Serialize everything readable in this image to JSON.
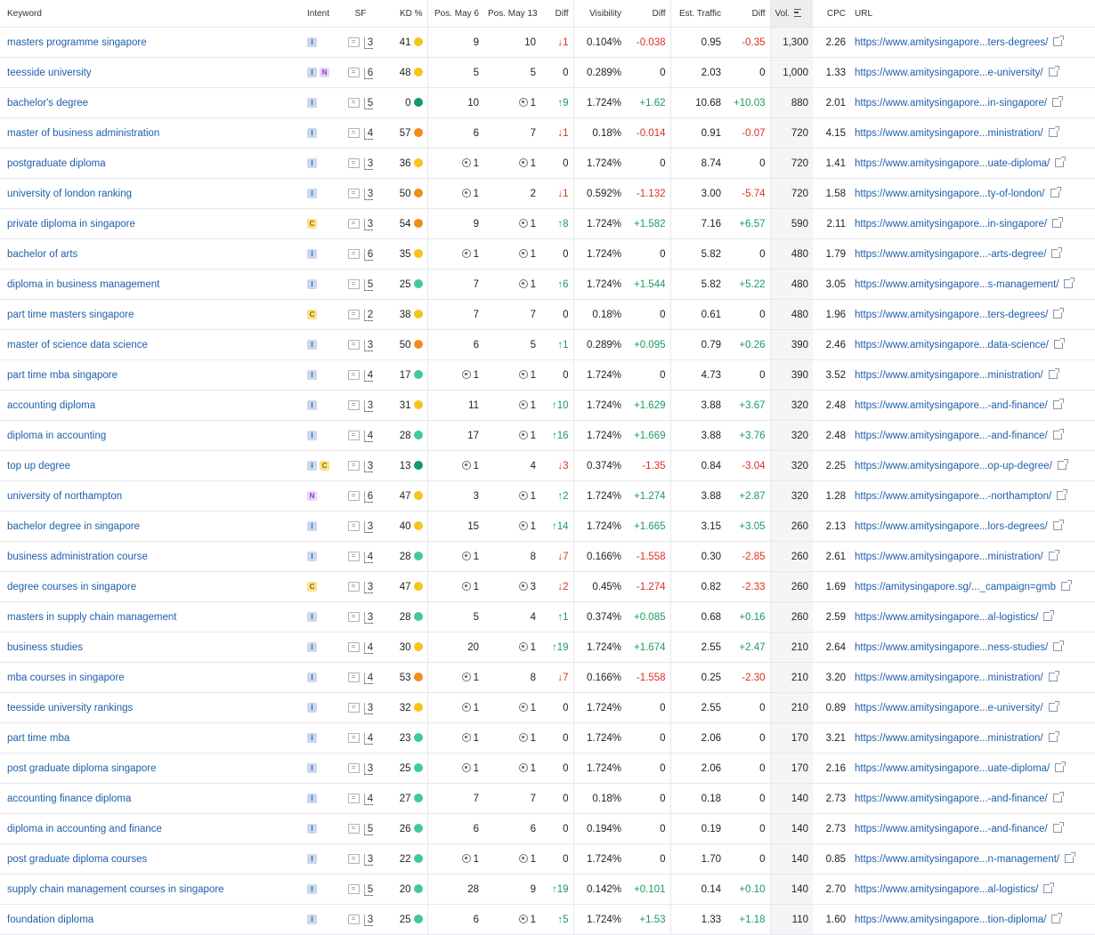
{
  "headers": {
    "keyword": "Keyword",
    "intent": "Intent",
    "sf": "SF",
    "kd": "KD %",
    "pos1": "Pos. May 6",
    "pos2": "Pos. May 13",
    "diff": "Diff",
    "visibility": "Visibility",
    "vdiff": "Diff",
    "traffic": "Est. Traffic",
    "tdiff": "Diff",
    "vol": "Vol.",
    "cpc": "CPC",
    "url": "URL"
  },
  "colors": {
    "link": "#1f5fa8",
    "up": "#1a9c5b",
    "down": "#d93025"
  },
  "rows": [
    {
      "kw": "masters programme singapore",
      "intent": [
        "I"
      ],
      "sf": "3",
      "kd": "41",
      "kdc": "yellow",
      "p1": "9",
      "p1f": false,
      "p2": "10",
      "p2f": false,
      "dir": "down",
      "dv": "1",
      "vis": "0.104%",
      "vd": "-0.038",
      "tr": "0.95",
      "td": "-0.35",
      "vol": "1,300",
      "cpc": "2.26",
      "url": "https://www.amitysingapore...ters-degrees/"
    },
    {
      "kw": "teesside university",
      "intent": [
        "I",
        "N"
      ],
      "sf": "6",
      "kd": "48",
      "kdc": "yellow",
      "p1": "5",
      "p1f": false,
      "p2": "5",
      "p2f": false,
      "dir": "none",
      "dv": "0",
      "vis": "0.289%",
      "vd": "0",
      "tr": "2.03",
      "td": "0",
      "vol": "1,000",
      "cpc": "1.33",
      "url": "https://www.amitysingapore...e-university/"
    },
    {
      "kw": "bachelor's degree",
      "intent": [
        "I"
      ],
      "sf": "5",
      "kd": "0",
      "kdc": "green",
      "p1": "10",
      "p1f": false,
      "p2": "1",
      "p2f": true,
      "dir": "up",
      "dv": "9",
      "vis": "1.724%",
      "vd": "+1.62",
      "tr": "10.68",
      "td": "+10.03",
      "vol": "880",
      "cpc": "2.01",
      "url": "https://www.amitysingapore...in-singapore/"
    },
    {
      "kw": "master of business administration",
      "intent": [
        "I"
      ],
      "sf": "4",
      "kd": "57",
      "kdc": "orange",
      "p1": "6",
      "p1f": false,
      "p2": "7",
      "p2f": false,
      "dir": "down",
      "dv": "1",
      "vis": "0.18%",
      "vd": "-0.014",
      "tr": "0.91",
      "td": "-0.07",
      "vol": "720",
      "cpc": "4.15",
      "url": "https://www.amitysingapore...ministration/"
    },
    {
      "kw": "postgraduate diploma",
      "intent": [
        "I"
      ],
      "sf": "3",
      "kd": "36",
      "kdc": "yellow",
      "p1": "1",
      "p1f": true,
      "p2": "1",
      "p2f": true,
      "dir": "none",
      "dv": "0",
      "vis": "1.724%",
      "vd": "0",
      "tr": "8.74",
      "td": "0",
      "vol": "720",
      "cpc": "1.41",
      "url": "https://www.amitysingapore...uate-diploma/"
    },
    {
      "kw": "university of london ranking",
      "intent": [
        "I"
      ],
      "sf": "3",
      "kd": "50",
      "kdc": "orange",
      "p1": "1",
      "p1f": true,
      "p2": "2",
      "p2f": false,
      "dir": "down",
      "dv": "1",
      "vis": "0.592%",
      "vd": "-1.132",
      "tr": "3.00",
      "td": "-5.74",
      "vol": "720",
      "cpc": "1.58",
      "url": "https://www.amitysingapore...ty-of-london/"
    },
    {
      "kw": "private diploma in singapore",
      "intent": [
        "C"
      ],
      "sf": "3",
      "kd": "54",
      "kdc": "orange",
      "p1": "9",
      "p1f": false,
      "p2": "1",
      "p2f": true,
      "dir": "up",
      "dv": "8",
      "vis": "1.724%",
      "vd": "+1.582",
      "tr": "7.16",
      "td": "+6.57",
      "vol": "590",
      "cpc": "2.11",
      "url": "https://www.amitysingapore...in-singapore/"
    },
    {
      "kw": "bachelor of arts",
      "intent": [
        "I"
      ],
      "sf": "6",
      "kd": "35",
      "kdc": "yellow",
      "p1": "1",
      "p1f": true,
      "p2": "1",
      "p2f": true,
      "dir": "none",
      "dv": "0",
      "vis": "1.724%",
      "vd": "0",
      "tr": "5.82",
      "td": "0",
      "vol": "480",
      "cpc": "1.79",
      "url": "https://www.amitysingapore...-arts-degree/"
    },
    {
      "kw": "diploma in business management",
      "intent": [
        "I"
      ],
      "sf": "5",
      "kd": "25",
      "kdc": "teal",
      "p1": "7",
      "p1f": false,
      "p2": "1",
      "p2f": true,
      "dir": "up",
      "dv": "6",
      "vis": "1.724%",
      "vd": "+1.544",
      "tr": "5.82",
      "td": "+5.22",
      "vol": "480",
      "cpc": "3.05",
      "url": "https://www.amitysingapore...s-management/"
    },
    {
      "kw": "part time masters singapore",
      "intent": [
        "C"
      ],
      "sf": "2",
      "kd": "38",
      "kdc": "yellow",
      "p1": "7",
      "p1f": false,
      "p2": "7",
      "p2f": false,
      "dir": "none",
      "dv": "0",
      "vis": "0.18%",
      "vd": "0",
      "tr": "0.61",
      "td": "0",
      "vol": "480",
      "cpc": "1.96",
      "url": "https://www.amitysingapore...ters-degrees/"
    },
    {
      "kw": "master of science data science",
      "intent": [
        "I"
      ],
      "sf": "3",
      "kd": "50",
      "kdc": "orange",
      "p1": "6",
      "p1f": false,
      "p2": "5",
      "p2f": false,
      "dir": "up",
      "dv": "1",
      "vis": "0.289%",
      "vd": "+0.095",
      "tr": "0.79",
      "td": "+0.26",
      "vol": "390",
      "cpc": "2.46",
      "url": "https://www.amitysingapore...data-science/"
    },
    {
      "kw": "part time mba singapore",
      "intent": [
        "I"
      ],
      "sf": "4",
      "kd": "17",
      "kdc": "teal",
      "p1": "1",
      "p1f": true,
      "p2": "1",
      "p2f": true,
      "dir": "none",
      "dv": "0",
      "vis": "1.724%",
      "vd": "0",
      "tr": "4.73",
      "td": "0",
      "vol": "390",
      "cpc": "3.52",
      "url": "https://www.amitysingapore...ministration/"
    },
    {
      "kw": "accounting diploma",
      "intent": [
        "I"
      ],
      "sf": "3",
      "kd": "31",
      "kdc": "yellow",
      "p1": "11",
      "p1f": false,
      "p2": "1",
      "p2f": true,
      "dir": "up",
      "dv": "10",
      "vis": "1.724%",
      "vd": "+1.629",
      "tr": "3.88",
      "td": "+3.67",
      "vol": "320",
      "cpc": "2.48",
      "url": "https://www.amitysingapore...-and-finance/"
    },
    {
      "kw": "diploma in accounting",
      "intent": [
        "I"
      ],
      "sf": "4",
      "kd": "28",
      "kdc": "teal",
      "p1": "17",
      "p1f": false,
      "p2": "1",
      "p2f": true,
      "dir": "up",
      "dv": "16",
      "vis": "1.724%",
      "vd": "+1.669",
      "tr": "3.88",
      "td": "+3.76",
      "vol": "320",
      "cpc": "2.48",
      "url": "https://www.amitysingapore...-and-finance/"
    },
    {
      "kw": "top up degree",
      "intent": [
        "I",
        "C"
      ],
      "sf": "3",
      "kd": "13",
      "kdc": "green",
      "p1": "1",
      "p1f": true,
      "p2": "4",
      "p2f": false,
      "dir": "down",
      "dv": "3",
      "vis": "0.374%",
      "vd": "-1.35",
      "tr": "0.84",
      "td": "-3.04",
      "vol": "320",
      "cpc": "2.25",
      "url": "https://www.amitysingapore...op-up-degree/"
    },
    {
      "kw": "university of northampton",
      "intent": [
        "N"
      ],
      "sf": "6",
      "kd": "47",
      "kdc": "yellow",
      "p1": "3",
      "p1f": false,
      "p2": "1",
      "p2f": true,
      "dir": "up",
      "dv": "2",
      "vis": "1.724%",
      "vd": "+1.274",
      "tr": "3.88",
      "td": "+2.87",
      "vol": "320",
      "cpc": "1.28",
      "url": "https://www.amitysingapore...-northampton/"
    },
    {
      "kw": "bachelor degree in singapore",
      "intent": [
        "I"
      ],
      "sf": "3",
      "kd": "40",
      "kdc": "yellow",
      "p1": "15",
      "p1f": false,
      "p2": "1",
      "p2f": true,
      "dir": "up",
      "dv": "14",
      "vis": "1.724%",
      "vd": "+1.665",
      "tr": "3.15",
      "td": "+3.05",
      "vol": "260",
      "cpc": "2.13",
      "url": "https://www.amitysingapore...lors-degrees/"
    },
    {
      "kw": "business administration course",
      "intent": [
        "I"
      ],
      "sf": "4",
      "kd": "28",
      "kdc": "teal",
      "p1": "1",
      "p1f": true,
      "p2": "8",
      "p2f": false,
      "dir": "down",
      "dv": "7",
      "vis": "0.166%",
      "vd": "-1.558",
      "tr": "0.30",
      "td": "-2.85",
      "vol": "260",
      "cpc": "2.61",
      "url": "https://www.amitysingapore...ministration/"
    },
    {
      "kw": "degree courses in singapore",
      "intent": [
        "C"
      ],
      "sf": "3",
      "kd": "47",
      "kdc": "yellow",
      "p1": "1",
      "p1f": true,
      "p2": "3",
      "p2f": true,
      "dir": "down",
      "dv": "2",
      "vis": "0.45%",
      "vd": "-1.274",
      "tr": "0.82",
      "td": "-2.33",
      "vol": "260",
      "cpc": "1.69",
      "url": "https://amitysingapore.sg/..._campaign=gmb"
    },
    {
      "kw": "masters in supply chain management",
      "intent": [
        "I"
      ],
      "sf": "3",
      "kd": "28",
      "kdc": "teal",
      "p1": "5",
      "p1f": false,
      "p2": "4",
      "p2f": false,
      "dir": "up",
      "dv": "1",
      "vis": "0.374%",
      "vd": "+0.085",
      "tr": "0.68",
      "td": "+0.16",
      "vol": "260",
      "cpc": "2.59",
      "url": "https://www.amitysingapore...al-logistics/"
    },
    {
      "kw": "business studies",
      "intent": [
        "I"
      ],
      "sf": "4",
      "kd": "30",
      "kdc": "yellow",
      "p1": "20",
      "p1f": false,
      "p2": "1",
      "p2f": true,
      "dir": "up",
      "dv": "19",
      "vis": "1.724%",
      "vd": "+1.674",
      "tr": "2.55",
      "td": "+2.47",
      "vol": "210",
      "cpc": "2.64",
      "url": "https://www.amitysingapore...ness-studies/"
    },
    {
      "kw": "mba courses in singapore",
      "intent": [
        "I"
      ],
      "sf": "4",
      "kd": "53",
      "kdc": "orange",
      "p1": "1",
      "p1f": true,
      "p2": "8",
      "p2f": false,
      "dir": "down",
      "dv": "7",
      "vis": "0.166%",
      "vd": "-1.558",
      "tr": "0.25",
      "td": "-2.30",
      "vol": "210",
      "cpc": "3.20",
      "url": "https://www.amitysingapore...ministration/"
    },
    {
      "kw": "teesside university rankings",
      "intent": [
        "I"
      ],
      "sf": "3",
      "kd": "32",
      "kdc": "yellow",
      "p1": "1",
      "p1f": true,
      "p2": "1",
      "p2f": true,
      "dir": "none",
      "dv": "0",
      "vis": "1.724%",
      "vd": "0",
      "tr": "2.55",
      "td": "0",
      "vol": "210",
      "cpc": "0.89",
      "url": "https://www.amitysingapore...e-university/"
    },
    {
      "kw": "part time mba",
      "intent": [
        "I"
      ],
      "sf": "4",
      "kd": "23",
      "kdc": "teal",
      "p1": "1",
      "p1f": true,
      "p2": "1",
      "p2f": true,
      "dir": "none",
      "dv": "0",
      "vis": "1.724%",
      "vd": "0",
      "tr": "2.06",
      "td": "0",
      "vol": "170",
      "cpc": "3.21",
      "url": "https://www.amitysingapore...ministration/"
    },
    {
      "kw": "post graduate diploma singapore",
      "intent": [
        "I"
      ],
      "sf": "3",
      "kd": "25",
      "kdc": "teal",
      "p1": "1",
      "p1f": true,
      "p2": "1",
      "p2f": true,
      "dir": "none",
      "dv": "0",
      "vis": "1.724%",
      "vd": "0",
      "tr": "2.06",
      "td": "0",
      "vol": "170",
      "cpc": "2.16",
      "url": "https://www.amitysingapore...uate-diploma/"
    },
    {
      "kw": "accounting finance diploma",
      "intent": [
        "I"
      ],
      "sf": "4",
      "kd": "27",
      "kdc": "teal",
      "p1": "7",
      "p1f": false,
      "p2": "7",
      "p2f": false,
      "dir": "none",
      "dv": "0",
      "vis": "0.18%",
      "vd": "0",
      "tr": "0.18",
      "td": "0",
      "vol": "140",
      "cpc": "2.73",
      "url": "https://www.amitysingapore...-and-finance/"
    },
    {
      "kw": "diploma in accounting and finance",
      "intent": [
        "I"
      ],
      "sf": "5",
      "kd": "26",
      "kdc": "teal",
      "p1": "6",
      "p1f": false,
      "p2": "6",
      "p2f": false,
      "dir": "none",
      "dv": "0",
      "vis": "0.194%",
      "vd": "0",
      "tr": "0.19",
      "td": "0",
      "vol": "140",
      "cpc": "2.73",
      "url": "https://www.amitysingapore...-and-finance/"
    },
    {
      "kw": "post graduate diploma courses",
      "intent": [
        "I"
      ],
      "sf": "3",
      "kd": "22",
      "kdc": "teal",
      "p1": "1",
      "p1f": true,
      "p2": "1",
      "p2f": true,
      "dir": "none",
      "dv": "0",
      "vis": "1.724%",
      "vd": "0",
      "tr": "1.70",
      "td": "0",
      "vol": "140",
      "cpc": "0.85",
      "url": "https://www.amitysingapore...n-management/"
    },
    {
      "kw": "supply chain management courses in singapore",
      "intent": [
        "I"
      ],
      "sf": "5",
      "kd": "20",
      "kdc": "teal",
      "p1": "28",
      "p1f": false,
      "p2": "9",
      "p2f": false,
      "dir": "up",
      "dv": "19",
      "vis": "0.142%",
      "vd": "+0.101",
      "tr": "0.14",
      "td": "+0.10",
      "vol": "140",
      "cpc": "2.70",
      "url": "https://www.amitysingapore...al-logistics/"
    },
    {
      "kw": "foundation diploma",
      "intent": [
        "I"
      ],
      "sf": "3",
      "kd": "25",
      "kdc": "teal",
      "p1": "6",
      "p1f": false,
      "p2": "1",
      "p2f": true,
      "dir": "up",
      "dv": "5",
      "vis": "1.724%",
      "vd": "+1.53",
      "tr": "1.33",
      "td": "+1.18",
      "vol": "110",
      "cpc": "1.60",
      "url": "https://www.amitysingapore...tion-diploma/"
    }
  ]
}
